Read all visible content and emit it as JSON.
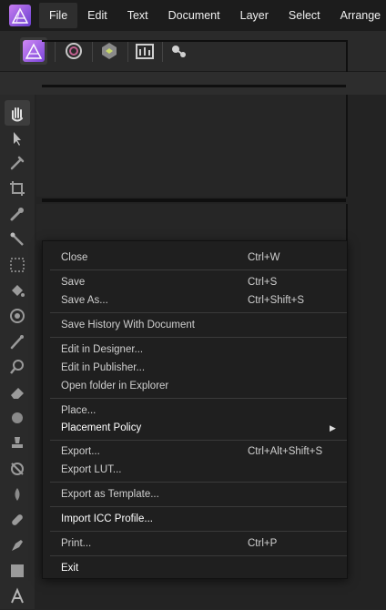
{
  "menubar": {
    "items": [
      {
        "label": "File",
        "active": true
      },
      {
        "label": "Edit"
      },
      {
        "label": "Text"
      },
      {
        "label": "Document"
      },
      {
        "label": "Layer"
      },
      {
        "label": "Select"
      },
      {
        "label": "Arrange"
      }
    ]
  },
  "toolbar": {
    "icons": [
      "photo-persona-icon",
      "liquify-persona-icon",
      "develop-persona-icon",
      "tone-mapping-persona-icon",
      "export-persona-icon"
    ]
  },
  "tools": [
    "view-tool-hand-icon",
    "move-tool-icon",
    "color-picker-icon",
    "crop-icon",
    "selection-brush-icon",
    "flood-select-icon",
    "marquee-icon",
    "flood-fill-icon",
    "gradient-icon",
    "paint-brush-icon",
    "dodge-icon",
    "erase-icon",
    "blur-icon",
    "clone-icon",
    "red-eye-icon",
    "liquify-icon",
    "healing-icon",
    "pen-icon",
    "shape-icon",
    "text-icon"
  ],
  "file_menu": {
    "items": [
      {
        "label": "Close",
        "shortcut": "Ctrl+W"
      },
      {
        "label": "Save",
        "shortcut": "Ctrl+S"
      },
      {
        "label": "Save As...",
        "shortcut": "Ctrl+Shift+S"
      },
      {
        "label": "Save History With Document"
      },
      {
        "label": "Edit in Designer..."
      },
      {
        "label": "Edit in Publisher..."
      },
      {
        "label": "Open folder in Explorer"
      },
      {
        "label": "Place..."
      },
      {
        "label": "Placement Policy",
        "submenu": true
      },
      {
        "label": "Export...",
        "shortcut": "Ctrl+Alt+Shift+S"
      },
      {
        "label": "Export LUT..."
      },
      {
        "label": "Export as Template..."
      },
      {
        "label": "Import ICC Profile..."
      },
      {
        "label": "Print...",
        "shortcut": "Ctrl+P"
      },
      {
        "label": "Exit"
      }
    ]
  },
  "colors": {
    "brand": "#a466e8",
    "menu_bg": "#1f1f1f",
    "toolbar_bg": "#2a2a2a"
  }
}
